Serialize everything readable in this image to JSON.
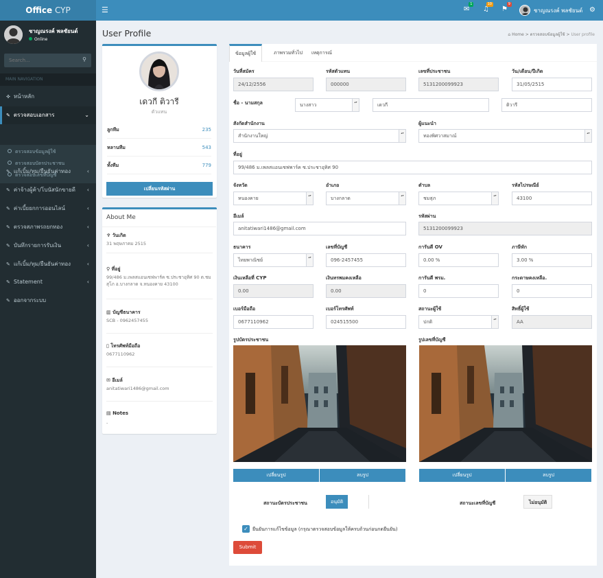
{
  "app": {
    "logo_bold": "Office",
    "logo_light": "CYP"
  },
  "topbar": {
    "mail_badge": "1",
    "bell_badge": "10",
    "flag_badge": "9",
    "user_name": "ชาญณรงค์ พลชัยนต์"
  },
  "sidebar": {
    "user_name": "ชาญณรงค์ พลชัยนต์",
    "status": "Online",
    "search_placeholder": "Search...",
    "section": "MAIN NAVIGATION",
    "items": [
      {
        "label": "หน้าหลัก"
      },
      {
        "label": "ตรวจสอบเอกสาร"
      },
      {
        "label": "แก้เบิ้ม/ทุม/ยืนยันค่าทอง"
      },
      {
        "label": "ค่าจ้างผู้ค้า/โบนัสนักขายดี"
      },
      {
        "label": "ค่าเบี้ยยกการออนไลน์"
      },
      {
        "label": "ตรวจสภาพรถยกทอง"
      },
      {
        "label": "บันทึกรายการรับเงิน"
      },
      {
        "label": "แก้เบิ้ม/ทุม/ยืนยันค่าทอง"
      },
      {
        "label": "Statement"
      },
      {
        "label": "ออกจากระบบ"
      }
    ],
    "sub_items": [
      {
        "label": "ตรวจสอบข้อมูลผู้ใช้"
      },
      {
        "label": "ตรวจสอบบัตรประชาชน"
      },
      {
        "label": "ตรวจสอบเลขที่บัญชี"
      }
    ]
  },
  "page": {
    "title": "User Profile",
    "breadcrumb_home": "Home",
    "breadcrumb_mid": "ตรวจสอบข้อมูลผู้ใช้",
    "breadcrumb_current": "User profile"
  },
  "profile": {
    "name": "เดวกี ติวารี",
    "position": "ตัวแทน",
    "stats": [
      {
        "label": "ลูกทีม",
        "value": "235"
      },
      {
        "label": "หลานทีม",
        "value": "543"
      },
      {
        "label": "ทั้งทีม",
        "value": "779"
      }
    ],
    "change_password_label": "เปลี่ยนรหัสผ่าน"
  },
  "about": {
    "title": "About Me",
    "birthday_label": "วันเกิด",
    "birthday": "31 พฤษภาคม 2515",
    "address_label": "ที่อยู่",
    "address": "99/486 ม.เพลสแอนเซฟพาร์ค ซ.ประชาอุทิศ 90 ต.ชมสุโภ อ.บางกลาด จ.หนองคาย 43100",
    "bank_label": "บัญชีธนาคาร",
    "bank": "SCB - 0962457455",
    "mobile_label": "โทรศัพท์มือถือ",
    "mobile": "0677110962",
    "email_label": "อีเมล์",
    "email": "anitatiwari1486@gmail.com",
    "notes_label": "Notes",
    "notes": "-"
  },
  "tabs": [
    {
      "label": "ข้อมูลผู้ใช้"
    },
    {
      "label": "ภาพรวมทั่วไป"
    },
    {
      "label": "เหตุการณ์"
    }
  ],
  "form": {
    "reg_date": {
      "label": "วันที่สมัคร",
      "value": "24/12/2556"
    },
    "agent_code": {
      "label": "รหัสตัวแทน",
      "value": "000000"
    },
    "id_card": {
      "label": "เลขที่ประชาชน",
      "value": "5131200099923"
    },
    "dob": {
      "label": "วัน/เดือน/ปีเกิด",
      "value": "31/05/2515"
    },
    "name_label": "ชื่อ - นามสกุล",
    "prefix": "นางสาว",
    "first_name": "เดวกี",
    "last_name": "ติวารี",
    "office": {
      "label": "สังกัดสำนักงาน",
      "value": "สำนักงานใหญ่"
    },
    "introducer": {
      "label": "ผู้แนะนำ",
      "value": "ทองพิศวาสมาณ์"
    },
    "address": {
      "label": "ที่อยู่",
      "value": "99/486 ม.เพลสแอนเซฟพาร์ค ซ.ประชาอุทิศ 90"
    },
    "province": {
      "label": "จังหวัด",
      "value": "หนองคาย"
    },
    "district": {
      "label": "อำเภอ",
      "value": "บางกลาด"
    },
    "subdistrict": {
      "label": "ตำบล",
      "value": "ชมสุภ"
    },
    "postcode": {
      "label": "รหัสไปรษณีย์",
      "value": "43100"
    },
    "email": {
      "label": "อีเมล์",
      "value": "anitatiwari1486@gmail.com"
    },
    "password": {
      "label": "รหัสผ่าน",
      "value": "5131200099923"
    },
    "bank": {
      "label": "ธนาคาร",
      "value": "ไทยพาณิชย์"
    },
    "account_no": {
      "label": "เลขที่บัญชี",
      "value": "096-2457455"
    },
    "ov_guarantee": {
      "label": "การันตี OV",
      "value": "0.00 %"
    },
    "tax": {
      "label": "ภาษีหัก",
      "value": "3.00 %"
    },
    "cyp_balance": {
      "label": "เงินเหลือที่ CYP",
      "value": "0.00"
    },
    "shop_balance": {
      "label": "เงินทรพมคงเหลือ",
      "value": "0.00"
    },
    "pm_guarantee": {
      "label": "การันตี พรม.",
      "value": "0"
    },
    "paper_balance": {
      "label": "กระดาษคงเหลือ.",
      "value": "0"
    },
    "mobile": {
      "label": "เบอร์มือถือ",
      "value": "0677110962"
    },
    "phone": {
      "label": "เบอร์โทรศัพท์",
      "value": "024515500"
    },
    "user_status": {
      "label": "สถานะผู้ใช้",
      "value": "ปกติ"
    },
    "user_rights": {
      "label": "สิทธิ์ผู้ใช้",
      "value": "AA"
    },
    "id_photo_label": "รูปบัตรประชาชน",
    "bank_photo_label": "รูปเลขที่บัญชี",
    "change_photo": "เปลี่ยนรูป",
    "delete_photo": "ลบรูป",
    "id_status_label": "สถานะบัตรประชาชน",
    "id_status_value": "อนุมัติ",
    "bank_status_label": "สถานะเลขที่บัญชี",
    "bank_status_value": "ไม่อนุมัติ",
    "confirm_text": "ยืนยันการแก้ไขข้อมูล (กรุณาตรวจสอบข้อมูลให้ครบถ้วนก่อนกดยืนยัน)",
    "submit": "Submit"
  },
  "colors": {
    "primary": "#3c8dbc",
    "sidebar": "#222d32",
    "danger": "#dd4b39"
  }
}
